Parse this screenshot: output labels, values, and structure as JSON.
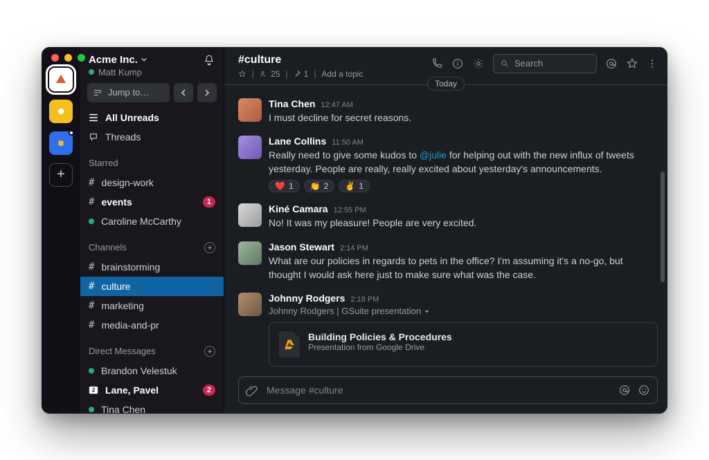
{
  "workspace": {
    "name": "Acme Inc.",
    "user_name": "Matt Kump",
    "jump_to": "Jump to…"
  },
  "sidebar": {
    "all_unreads": "All Unreads",
    "threads": "Threads",
    "sections": {
      "starred_title": "Starred",
      "channels_title": "Channels",
      "dm_title": "Direct Messages"
    },
    "starred": [
      {
        "type": "channel",
        "label": "design-work",
        "unread": false
      },
      {
        "type": "channel",
        "label": "events",
        "unread": true,
        "badge": "1"
      },
      {
        "type": "dm",
        "label": "Caroline McCarthy",
        "presence": "active"
      }
    ],
    "channels": [
      {
        "label": "brainstorming"
      },
      {
        "label": "culture",
        "active": true
      },
      {
        "label": "marketing"
      },
      {
        "label": "media-and-pr"
      }
    ],
    "dms": [
      {
        "label": "Brandon Velestuk",
        "presence": "active"
      },
      {
        "label": "Lane, Pavel",
        "unread": true,
        "badge": "2",
        "group": true
      },
      {
        "label": "Tina Chen",
        "presence": "active"
      }
    ]
  },
  "channel": {
    "name": "#culture",
    "members": "25",
    "pins": "1",
    "topic_placeholder": "Add a topic",
    "date_divider": "Today"
  },
  "toolbar": {
    "search_placeholder": "Search"
  },
  "messages": [
    {
      "id": "m1",
      "name": "Tina Chen",
      "time": "12:47 AM",
      "avatar": "av1",
      "text": "I must decline for secret reasons."
    },
    {
      "id": "m2",
      "name": "Lane Collins",
      "time": "11:50 AM",
      "avatar": "av2",
      "text_pre": "Really need to give some kudos to ",
      "mention": "@julie",
      "text_post": " for helping out with the new influx of tweets yesterday. People are really, really excited about yesterday's announcements.",
      "reactions": [
        {
          "e": "❤️",
          "c": "1"
        },
        {
          "e": "👏",
          "c": "2"
        },
        {
          "e": "✌️",
          "c": "1"
        }
      ]
    },
    {
      "id": "m3",
      "name": "Kiné Camara",
      "time": "12:55 PM",
      "avatar": "av3",
      "text": "No! It was my pleasure! People are very excited."
    },
    {
      "id": "m4",
      "name": "Jason Stewart",
      "time": "2:14 PM",
      "avatar": "av4",
      "text": "What are our policies in regards to pets in the office? I'm assuming it's a no-go, but thought I would ask here just to make sure what was the case."
    },
    {
      "id": "m5",
      "name": "Johnny Rodgers",
      "time": "2:18 PM",
      "avatar": "av5",
      "attachment_label": "Johnny Rodgers | GSuite presentation",
      "attachment": {
        "title": "Building Policies & Procedures",
        "subtitle": "Presentation from Google Drive"
      }
    }
  ],
  "compose": {
    "placeholder": "Message #culture"
  }
}
